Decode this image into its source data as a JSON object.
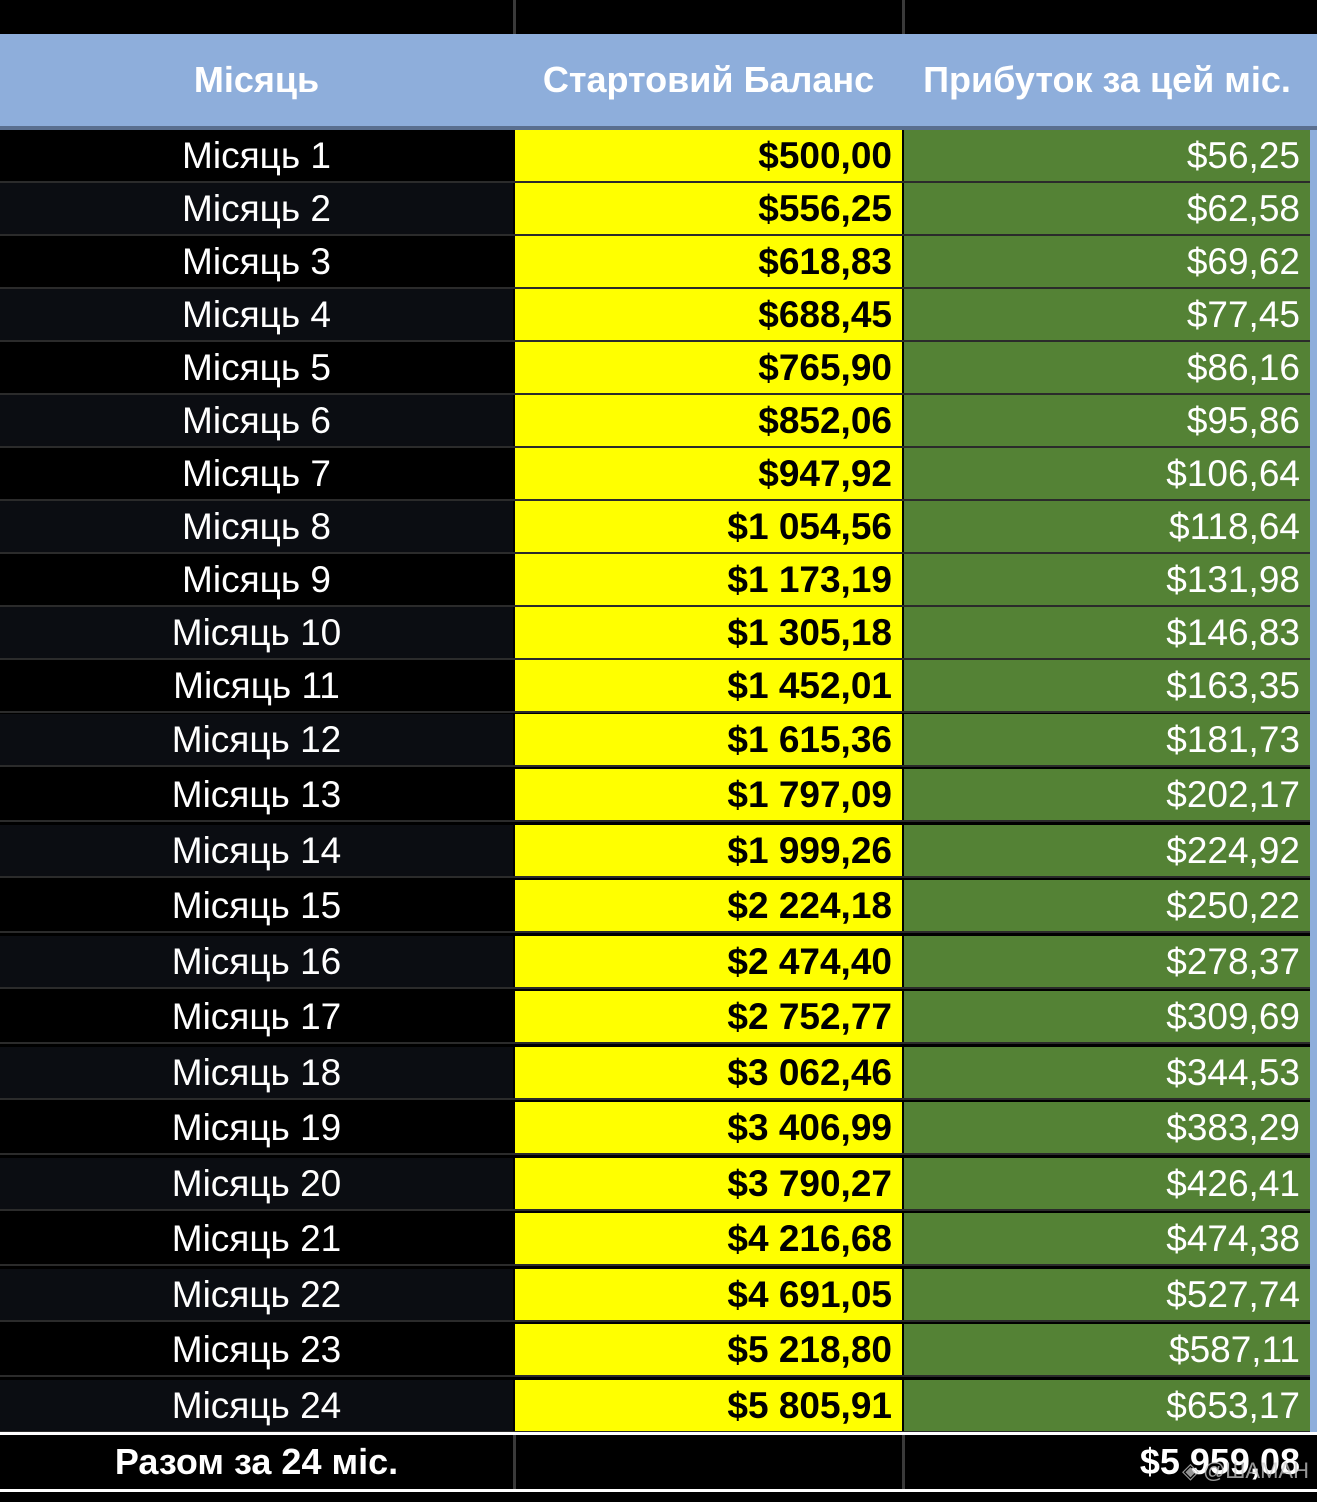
{
  "header": {
    "col_month": "Місяць",
    "col_balance": "Стартовий Баланс",
    "col_profit": "Прибуток за цей міс."
  },
  "rows": [
    {
      "month": "Місяць 1",
      "balance": "$500,00",
      "profit": "$56,25"
    },
    {
      "month": "Місяць 2",
      "balance": "$556,25",
      "profit": "$62,58"
    },
    {
      "month": "Місяць 3",
      "balance": "$618,83",
      "profit": "$69,62"
    },
    {
      "month": "Місяць 4",
      "balance": "$688,45",
      "profit": "$77,45"
    },
    {
      "month": "Місяць 5",
      "balance": "$765,90",
      "profit": "$86,16"
    },
    {
      "month": "Місяць 6",
      "balance": "$852,06",
      "profit": "$95,86"
    },
    {
      "month": "Місяць 7",
      "balance": "$947,92",
      "profit": "$106,64"
    },
    {
      "month": "Місяць 8",
      "balance": "$1 054,56",
      "profit": "$118,64"
    },
    {
      "month": "Місяць 9",
      "balance": "$1 173,19",
      "profit": "$131,98"
    },
    {
      "month": "Місяць 10",
      "balance": "$1 305,18",
      "profit": "$146,83"
    },
    {
      "month": "Місяць 11",
      "balance": "$1 452,01",
      "profit": "$163,35"
    },
    {
      "month": "Місяць 12",
      "balance": "$1 615,36",
      "profit": "$181,73"
    },
    {
      "month": "Місяць 13",
      "balance": "$1 797,09",
      "profit": "$202,17"
    },
    {
      "month": "Місяць 14",
      "balance": "$1 999,26",
      "profit": "$224,92"
    },
    {
      "month": "Місяць 15",
      "balance": "$2 224,18",
      "profit": "$250,22"
    },
    {
      "month": "Місяць 16",
      "balance": "$2 474,40",
      "profit": "$278,37"
    },
    {
      "month": "Місяць 17",
      "balance": "$2 752,77",
      "profit": "$309,69"
    },
    {
      "month": "Місяць 18",
      "balance": "$3 062,46",
      "profit": "$344,53"
    },
    {
      "month": "Місяць 19",
      "balance": "$3 406,99",
      "profit": "$383,29"
    },
    {
      "month": "Місяць 20",
      "balance": "$3 790,27",
      "profit": "$426,41"
    },
    {
      "month": "Місяць 21",
      "balance": "$4 216,68",
      "profit": "$474,38"
    },
    {
      "month": "Місяць 22",
      "balance": "$4 691,05",
      "profit": "$527,74"
    },
    {
      "month": "Місяць 23",
      "balance": "$5 218,80",
      "profit": "$587,11"
    },
    {
      "month": "Місяць 24",
      "balance": "$5 805,91",
      "profit": "$653,17"
    }
  ],
  "total": {
    "label": "Разом за 24 міс.",
    "value": "$5 959,08"
  },
  "watermark": {
    "text": "@ШАМАН",
    "icon": "exchange-logo-icon"
  },
  "colors": {
    "header_bg": "#8eaedb",
    "balance_bg": "#ffff00",
    "profit_bg": "#548235",
    "sheet_bg": "#000000"
  }
}
